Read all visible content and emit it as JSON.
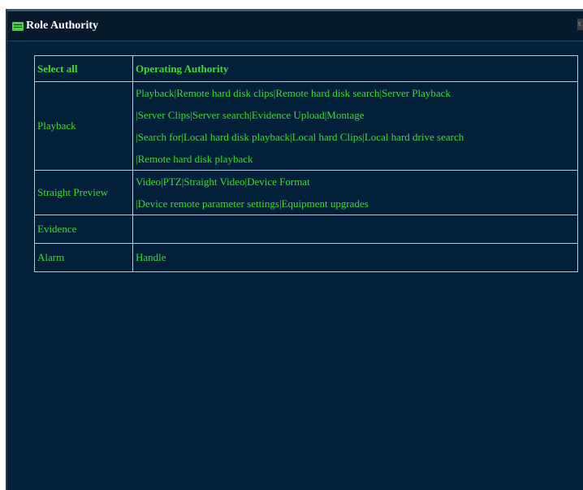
{
  "window": {
    "title": "Role Authority",
    "icon": "role-card-icon",
    "close_label": "x"
  },
  "table": {
    "headers": [
      "Select all",
      "Operating Authority"
    ],
    "rows": [
      {
        "name": "Playback",
        "lines": [
          "Playback|Remote hard disk clips|Remote hard disk search|Server Playback",
          "|Server Clips|Server search|Evidence Upload|Montage",
          "|Search for|Local hard disk playback|Local hard Clips|Local hard drive search",
          "|Remote hard disk playback"
        ]
      },
      {
        "name": "Straight Preview",
        "lines": [
          "Video|PTZ|Straight Video|Device Format",
          "|Device remote parameter settings|Equipment upgrades"
        ]
      },
      {
        "name": "Evidence",
        "lines": []
      },
      {
        "name": "Alarm",
        "lines": [
          "Handle"
        ]
      }
    ]
  },
  "colors": {
    "background": "#03203a",
    "text": "#3fdc2f",
    "border": "#b9c6d2"
  }
}
